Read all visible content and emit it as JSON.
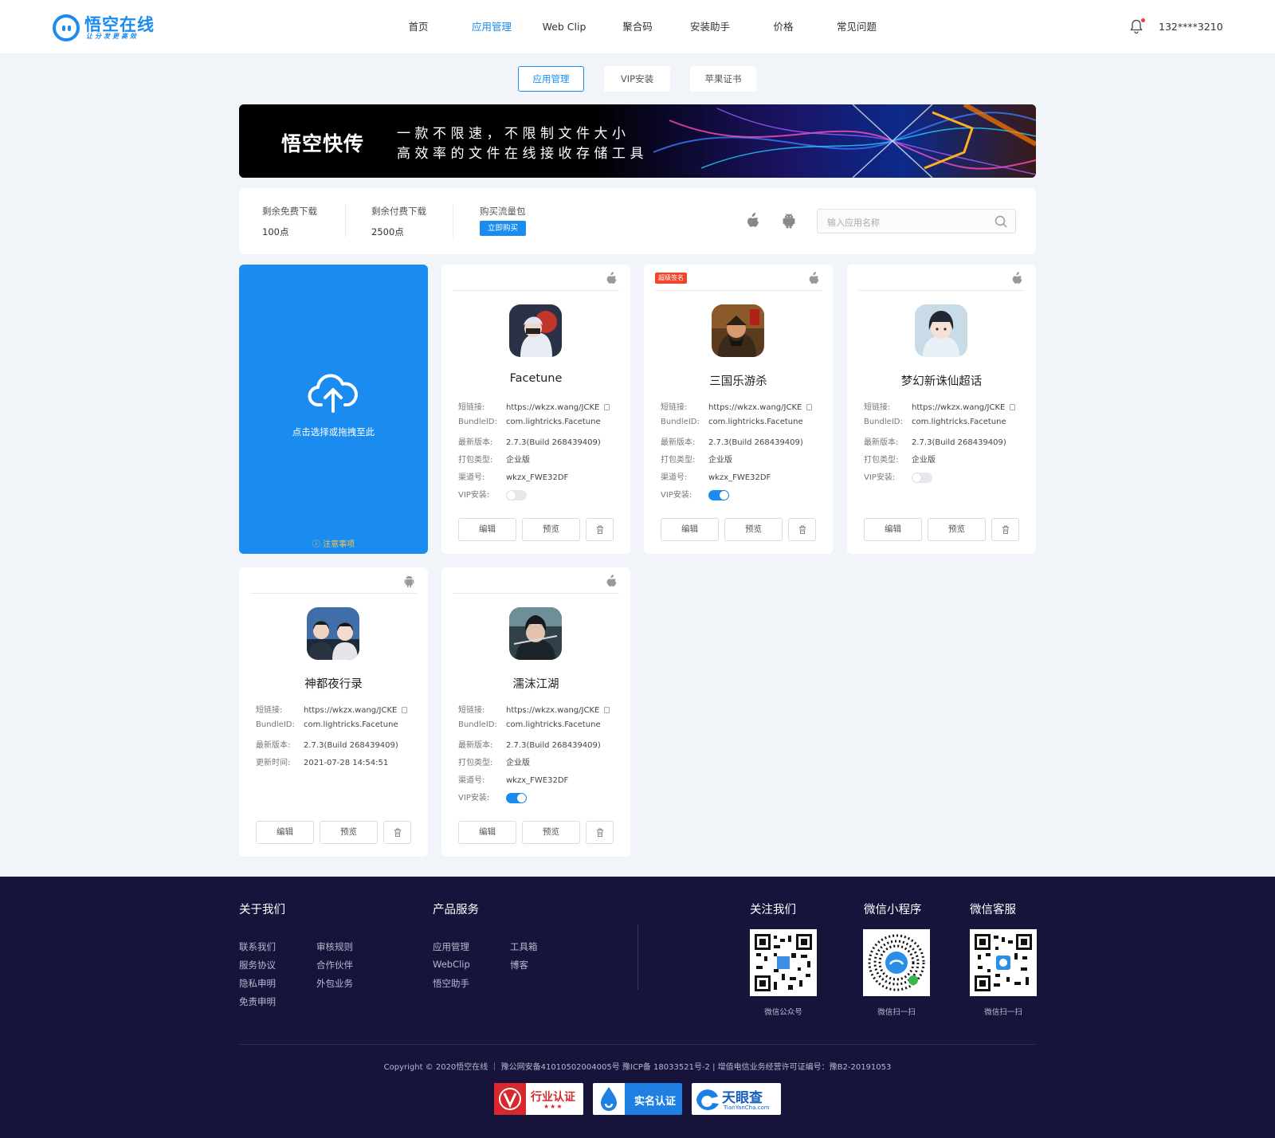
{
  "header": {
    "logo_title": "悟空在线",
    "logo_slogan": "让分发更高效",
    "nav": [
      "首页",
      "应用管理",
      "Web Clip",
      "聚合码",
      "安装助手",
      "价格",
      "常见问题"
    ],
    "phone": "132****3210"
  },
  "subtabs": [
    "应用管理",
    "VIP安装",
    "苹果证书"
  ],
  "banner": {
    "title": "悟空快传",
    "line1": "一款不限速，不限制文件大小",
    "line2": "高效率的文件在线接收存储工具"
  },
  "stats": {
    "free_label": "剩余免费下载",
    "free_value": "100点",
    "paid_label": "剩余付费下载",
    "paid_value": "2500点",
    "buy_label": "购买流量包",
    "buy_button": "立即购买",
    "search_placeholder": "输入应用名称"
  },
  "upload": {
    "text": "点击选择或拖拽至此",
    "notice": "注意事项"
  },
  "labels": {
    "link": "短链接:",
    "bundle": "BundleID:",
    "version": "最新版本:",
    "pack": "打包类型:",
    "channel": "渠道号:",
    "vip": "VIP安装:",
    "updated": "更新时间:",
    "edit": "编辑",
    "preview": "预览"
  },
  "apps": [
    {
      "name": "Facetune",
      "link": "https://wkzx.wang/JCKE",
      "bundle": "com.lightricks.Facetune",
      "version": "2.7.3(Build 268439409)",
      "pack": "企业版",
      "channel": "wkzx_FWE32DF",
      "vip": false,
      "os": "apple-icon"
    },
    {
      "name": "三国乐游杀",
      "badge": "超级签名",
      "link": "https://wkzx.wang/JCKE",
      "bundle": "com.lightricks.Facetune",
      "version": "2.7.3(Build 268439409)",
      "pack": "企业版",
      "channel": "wkzx_FWE32DF",
      "vip": true,
      "os": "apple-icon"
    },
    {
      "name": "梦幻新诛仙超话",
      "link": "https://wkzx.wang/JCKE",
      "bundle": "com.lightricks.Facetune",
      "version": "2.7.3(Build 268439409)",
      "pack": "企业版",
      "vip": false,
      "os": "apple-icon"
    },
    {
      "name": "神都夜行录",
      "link": "https://wkzx.wang/JCKE",
      "bundle": "com.lightricks.Facetune",
      "version": "2.7.3(Build 268439409)",
      "updated": "2021-07-28 14:54:51",
      "os": "android-icon"
    },
    {
      "name": "濡沫江湖",
      "link": "https://wkzx.wang/JCKE",
      "bundle": "com.lightricks.Facetune",
      "version": "2.7.3(Build 268439409)",
      "pack": "企业版",
      "channel": "wkzx_FWE32DF",
      "vip": true,
      "os": "apple-icon"
    }
  ],
  "footer": {
    "about_title": "关于我们",
    "about_links": [
      "联系我们",
      "服务协议",
      "隐私申明",
      "免责申明",
      "审核规则",
      "合作伙伴",
      "外包业务"
    ],
    "product_title": "产品服务",
    "product_links": [
      "应用管理",
      "WebClip",
      "悟空助手",
      "工具箱",
      "博客"
    ],
    "follow_title": "关注我们",
    "follow_caption": "微信公众号",
    "mini_title": "微信小程序",
    "mini_caption": "微信扫一扫",
    "service_title": "微信客服",
    "service_caption": "微信扫一扫",
    "copyright": "Copyright © 2020悟空在线 ｜ 豫公网安备41010502004005号 豫ICP备 18033521号-2 | 增值电信业务经营许可证编号：豫B2-20191053",
    "certs": [
      "行业认证",
      "实名认证",
      "天眼查"
    ],
    "tianyancha_domain": "TianYanCha.com"
  },
  "colors": {
    "primary": "#1a8cf0",
    "footer_bg": "#16143a",
    "badge": "#f0452a",
    "notice": "#f7c04a"
  }
}
